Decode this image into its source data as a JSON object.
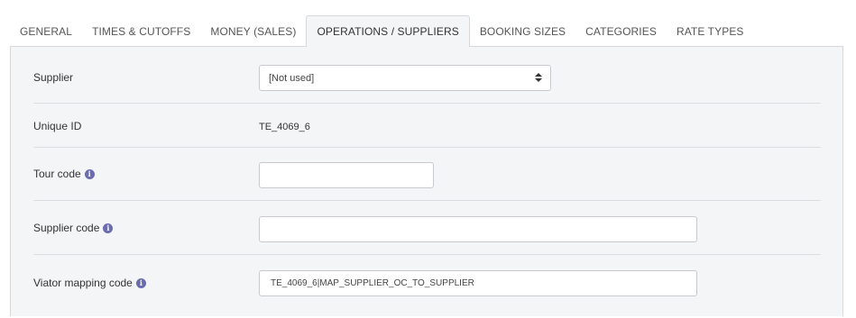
{
  "tabs": [
    {
      "label": "GENERAL"
    },
    {
      "label": "TIMES & CUTOFFS"
    },
    {
      "label": "MONEY (SALES)"
    },
    {
      "label": "OPERATIONS / SUPPLIERS"
    },
    {
      "label": "BOOKING SIZES"
    },
    {
      "label": "CATEGORIES"
    },
    {
      "label": "RATE TYPES"
    }
  ],
  "active_tab": "OPERATIONS / SUPPLIERS",
  "form": {
    "supplier": {
      "label": "Supplier",
      "value": "[Not used]"
    },
    "unique_id": {
      "label": "Unique ID",
      "value": "TE_4069_6"
    },
    "tour_code": {
      "label": "Tour code",
      "value": ""
    },
    "supplier_code": {
      "label": "Supplier code",
      "value": ""
    },
    "viator_mapping_code": {
      "label": "Viator mapping code",
      "value": "TE_4069_6|MAP_SUPPLIER_OC_TO_SUPPLIER"
    }
  },
  "info_icon_glyph": "i",
  "colors": {
    "info_icon": "#6b6bb0",
    "panel_bg": "#f4f5f7"
  }
}
